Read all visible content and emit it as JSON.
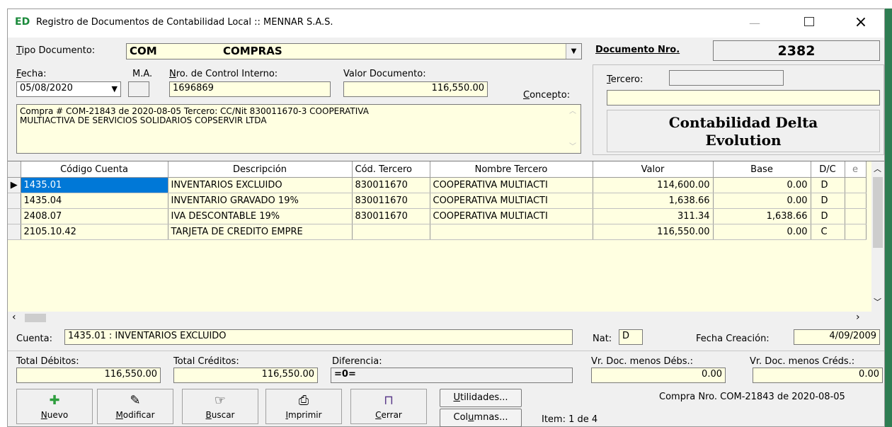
{
  "window": {
    "title": "Registro de Documentos de Contabilidad Local :: MENNAR S.A.S.",
    "app_icon": "ED"
  },
  "header": {
    "tipo_label_u": "T",
    "tipo_label_rest": "ipo Documento:",
    "tipo_code": "COM",
    "tipo_name": "COMPRAS",
    "docnro_label": "Documento Nro.",
    "docnro_value": "2382"
  },
  "form": {
    "fecha_label_u": "F",
    "fecha_label_rest": "echa:",
    "fecha_value": "05/08/2020",
    "ma_label": "M.A.",
    "control_label_u": "N",
    "control_label_rest": "ro. de Control Interno:",
    "control_value": "1696869",
    "valor_label": "Valor Documento:",
    "valor_value": "116,550.00",
    "concepto_label_u": "C",
    "concepto_label_rest": "oncepto:",
    "tercero_label_u": "T",
    "tercero_label_rest": "ercero:",
    "concepto_text_1": "Compra # COM-21843 de 2020-08-05 Tercero: CC/Nit 830011670-3 COOPERATIVA",
    "concepto_text_2": "MULTIACTIVA DE SERVICIOS SOLIDARIOS COPSERVIR LTDA",
    "brand_line1": "Contabilidad Delta",
    "brand_line2": "Evolution"
  },
  "grid": {
    "columns": [
      "Código Cuenta",
      "Descripción",
      "Cód. Tercero",
      "Nombre Tercero",
      "Valor",
      "Base",
      "D/C",
      "e"
    ],
    "rows": [
      [
        "1435.01",
        "INVENTARIOS EXCLUIDO",
        "830011670",
        "COOPERATIVA MULTIACTI",
        "114,600.00",
        "0.00",
        "D"
      ],
      [
        "1435.04",
        "INVENTARIO GRAVADO 19%",
        "830011670",
        "COOPERATIVA MULTIACTI",
        "1,638.66",
        "0.00",
        "D"
      ],
      [
        "2408.07",
        "IVA DESCONTABLE 19%",
        "830011670",
        "COOPERATIVA MULTIACTI",
        "311.34",
        "1,638.66",
        "D"
      ],
      [
        "2105.10.42",
        "TARJETA DE CREDITO EMPRE",
        "",
        "",
        "116,550.00",
        "0.00",
        "C"
      ]
    ]
  },
  "footer": {
    "cuenta_label": "Cuenta:",
    "cuenta_value": "1435.01 : INVENTARIOS EXCLUIDO",
    "nat_label": "Nat:",
    "nat_value": "D",
    "fecha_creacion_label": "Fecha Creación:",
    "fecha_creacion_value": "4/09/2009",
    "total_debitos_label": "Total Débitos:",
    "total_debitos_value": "116,550.00",
    "total_creditos_label": "Total Créditos:",
    "total_creditos_value": "116,550.00",
    "diferencia_label": "Diferencia:",
    "diferencia_value": "=0=",
    "vr_debs_label": "Vr. Doc. menos Débs.:",
    "vr_debs_value": "0.00",
    "vr_creds_label": "Vr. Doc. menos Créds.:",
    "vr_creds_value": "0.00"
  },
  "buttons": {
    "nuevo_u": "N",
    "nuevo_rest": "uevo",
    "modificar_u": "M",
    "modificar_rest": "odificar",
    "buscar_u": "B",
    "buscar_rest": "uscar",
    "imprimir_u": "I",
    "imprimir_rest": "mprimir",
    "cerrar_u": "C",
    "cerrar_rest": "errar",
    "utilidades_u": "U",
    "utilidades_rest": "tilidades...",
    "columnas_pre": "Col",
    "columnas_u": "u",
    "columnas_rest": "mnas..."
  },
  "status": {
    "item": "Item: 1 de 4",
    "compra": "Compra Nro. COM-21843 de 2020-08-05"
  },
  "colors": {
    "field_bg": "#ffffe1",
    "selection": "#0078d7",
    "brand_green": "#1b8a3b"
  }
}
